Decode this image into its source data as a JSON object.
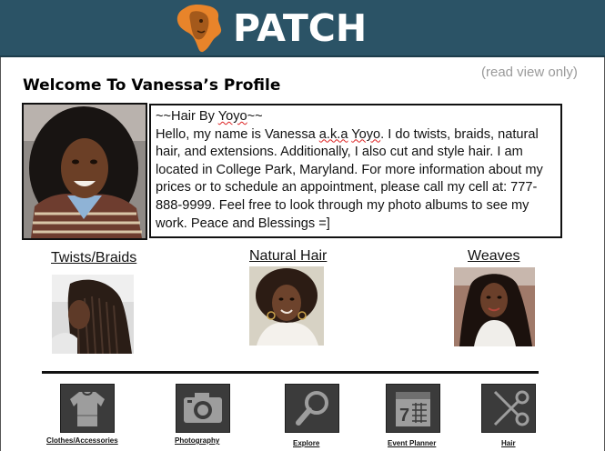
{
  "header": {
    "brand": "PATCH",
    "logo_icon": "africa-face-logo-icon"
  },
  "view_note": "(read view only)",
  "page_title": "Welcome To Vanessa’s Profile",
  "profile": {
    "bio_heading": "~~Hair By Yoyo~~",
    "bio_body": "Hello, my name is Vanessa a.k.a Yoyo. I do twists, braids, natural hair, and extensions. Additionally, I also cut and style hair. I am located in College Park, Maryland. For more information about my prices or to schedule an appointment, please call my cell at: 777-888-9999. Feel free to look through my photo albums to see my work. Peace and Blessings =]"
  },
  "albums": [
    {
      "label": "Twists/Braids"
    },
    {
      "label": "Natural Hair"
    },
    {
      "label": "Weaves"
    }
  ],
  "nav": [
    {
      "label": "Clothes/Accessories",
      "icon": "clothes-icon"
    },
    {
      "label": "Photography",
      "icon": "camera-icon"
    },
    {
      "label": "Explore",
      "icon": "magnifier-icon"
    },
    {
      "label": "Event Planner",
      "icon": "calendar-icon"
    },
    {
      "label": "Hair",
      "icon": "scissors-icon"
    }
  ],
  "colors": {
    "header_bg": "#2b5366",
    "logo_orange": "#e8842a",
    "icon_bg": "#3b3b3b"
  }
}
